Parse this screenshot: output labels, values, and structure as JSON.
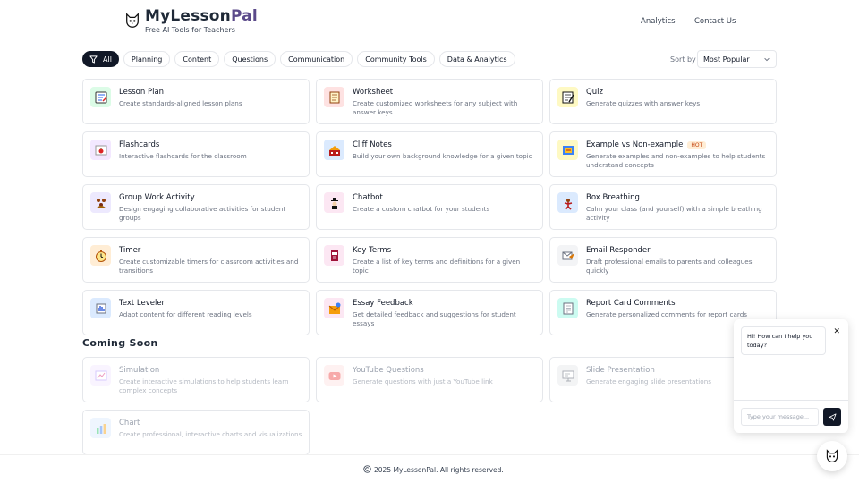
{
  "header": {
    "brand_part1": "MyLesson",
    "brand_part2": "Pal",
    "tagline": "Free AI Tools for Teachers",
    "nav": [
      "Analytics",
      "Contact Us"
    ]
  },
  "filters": {
    "chips": [
      "All",
      "Planning",
      "Content",
      "Questions",
      "Communication",
      "Community Tools",
      "Data & Analytics"
    ],
    "active_index": 0,
    "sort_label": "Sort by",
    "sort_value": "Most Popular"
  },
  "tools": [
    {
      "title": "Lesson Plan",
      "desc": "Create standards-aligned lesson plans",
      "icon": "lesson-plan-icon"
    },
    {
      "title": "Worksheet",
      "desc": "Create customized worksheets for any subject with answer keys",
      "icon": "worksheet-icon"
    },
    {
      "title": "Quiz",
      "desc": "Generate quizzes with answer keys",
      "icon": "quiz-icon"
    },
    {
      "title": "Flashcards",
      "desc": "Interactive flashcards for the classroom",
      "icon": "flashcards-icon"
    },
    {
      "title": "Cliff Notes",
      "desc": "Build your own background knowledge for a given topic",
      "icon": "cliff-notes-icon"
    },
    {
      "title": "Example vs Non-example",
      "desc": "Generate examples and non-examples to help students understand concepts",
      "icon": "example-icon",
      "badge": "HOT"
    },
    {
      "title": "Group Work Activity",
      "desc": "Design engaging collaborative activities for student groups",
      "icon": "group-work-icon"
    },
    {
      "title": "Chatbot",
      "desc": "Create a custom chatbot for your students",
      "icon": "chatbot-icon"
    },
    {
      "title": "Box Breathing",
      "desc": "Calm your class (and yourself) with a simple breathing activity",
      "icon": "box-breathing-icon"
    },
    {
      "title": "Timer",
      "desc": "Create customizable timers for classroom activities and transitions",
      "icon": "timer-icon"
    },
    {
      "title": "Key Terms",
      "desc": "Create a list of key terms and definitions for a given topic",
      "icon": "key-terms-icon"
    },
    {
      "title": "Email Responder",
      "desc": "Draft professional emails to parents and colleagues quickly",
      "icon": "email-icon"
    },
    {
      "title": "Text Leveler",
      "desc": "Adapt content for different reading levels",
      "icon": "text-leveler-icon"
    },
    {
      "title": "Essay Feedback",
      "desc": "Get detailed feedback and suggestions for student essays",
      "icon": "essay-feedback-icon"
    },
    {
      "title": "Report Card Comments",
      "desc": "Generate personalized comments for report cards",
      "icon": "report-card-icon"
    }
  ],
  "coming_soon": {
    "title": "Coming Soon",
    "items": [
      {
        "title": "Simulation",
        "desc": "Create interactive simulations to help students learn complex concepts",
        "icon": "simulation-icon"
      },
      {
        "title": "YouTube Questions",
        "desc": "Generate questions with just a YouTube link",
        "icon": "youtube-icon"
      },
      {
        "title": "Slide Presentation",
        "desc": "Generate engaging slide presentations",
        "icon": "slide-icon"
      },
      {
        "title": "Chart",
        "desc": "Create professional, interactive charts and visualizations",
        "icon": "chart-icon"
      }
    ]
  },
  "footer": {
    "text": "2025 MyLessonPal. All rights reserved."
  },
  "chat": {
    "greeting": "Hi! How can I help you today?",
    "input_placeholder": "Type your message..."
  },
  "colors": {
    "accent": "#111827",
    "brand_purple": "#5b4a8a",
    "hot_badge": "#ffedd5"
  }
}
